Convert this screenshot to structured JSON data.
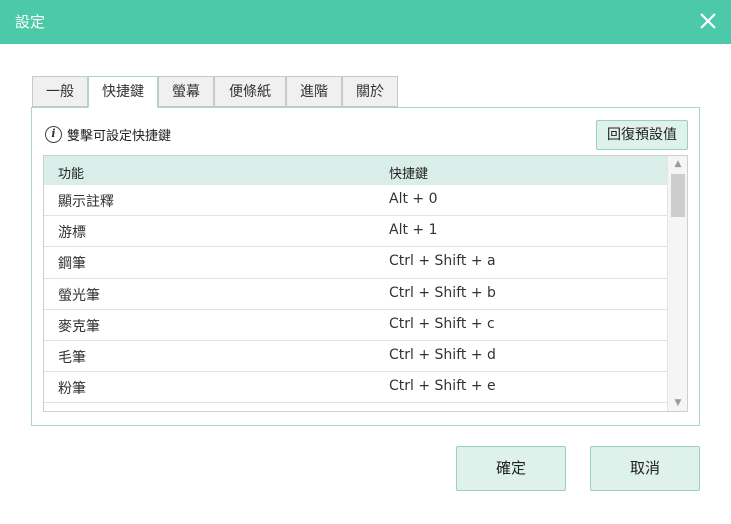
{
  "window": {
    "title": "設定",
    "close_icon": "close-icon"
  },
  "tabs": [
    {
      "label": "一般",
      "active": false
    },
    {
      "label": "快捷鍵",
      "active": true
    },
    {
      "label": "螢幕",
      "active": false
    },
    {
      "label": "便條紙",
      "active": false
    },
    {
      "label": "進階",
      "active": false
    },
    {
      "label": "關於",
      "active": false
    }
  ],
  "panel": {
    "hint_icon": "info-icon",
    "hint": "雙擊可設定快捷鍵",
    "reset_label": "回復預設值"
  },
  "table": {
    "headers": [
      "功能",
      "快捷鍵"
    ],
    "rows": [
      [
        "顯示註釋",
        "Alt + 0"
      ],
      [
        "游標",
        "Alt + 1"
      ],
      [
        "鋼筆",
        "Ctrl + Shift + a"
      ],
      [
        "螢光筆",
        "Ctrl + Shift + b"
      ],
      [
        "麥克筆",
        "Ctrl + Shift + c"
      ],
      [
        "毛筆",
        "Ctrl + Shift + d"
      ],
      [
        "粉筆",
        "Ctrl + Shift + e"
      ]
    ]
  },
  "footer": {
    "ok_label": "確定",
    "cancel_label": "取消"
  },
  "colors": {
    "accent": "#4cc9a9",
    "button_bg": "#dff1eb",
    "header_bg": "#d9eee8"
  }
}
